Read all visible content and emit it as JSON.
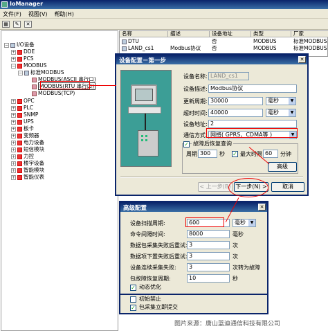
{
  "window": {
    "title": "IoManager"
  },
  "menubar": [
    "文件(F)",
    "视图(V)",
    "帮助(H)"
  ],
  "tree": {
    "root": "I/O设备",
    "items": [
      "DDE",
      "PCS",
      "MODBUS",
      "标准MODBUS",
      "MODBUS(ASCII 串行口)",
      "MODBUS(RTU 串行口)",
      "MODBUS(TCP)",
      "OPC",
      "PLC",
      "SNMP",
      "UPS",
      "板卡",
      "变频器",
      "电力设备",
      "短信模块",
      "力控",
      "楼宇设备",
      "智能模块",
      "智能仪表"
    ]
  },
  "device_list": {
    "columns": [
      "名称",
      "描述",
      "设备地址",
      "类型",
      "厂家"
    ],
    "rows": [
      [
        "DTU",
        "",
        "否",
        "MODBUS",
        "标准MODBUS"
      ],
      [
        "LAND_cs1",
        "Modbus协议",
        "否",
        "MODBUS",
        "标准MODBUS"
      ]
    ]
  },
  "dialog1": {
    "title": "设备配置－第一步",
    "fields": {
      "name_label": "设备名称:",
      "name_value": "LAND_cs1",
      "desc_label": "设备描述:",
      "desc_value": "Modbus协议",
      "update_label": "更新周期:",
      "update_value": "30000",
      "update_unit": "毫秒",
      "timeout_label": "超时时间:",
      "timeout_value": "40000",
      "timeout_unit": "毫秒",
      "addr_label": "设备地址:",
      "addr_value": "2",
      "comm_label": "通信方式:",
      "comm_value": "网络( GPRS、CDMA等 )"
    },
    "recovery": {
      "title": "故障后恢复查询",
      "period_label": "周期:",
      "period_value": "300",
      "period_unit": "秒",
      "max_label": "最大时限",
      "max_value": "60",
      "max_unit": "分钟",
      "max_checked": "✓"
    },
    "advanced_button": "高级",
    "prev_button": "< 上一步(B)",
    "next_button": "下一步(N) >",
    "cancel_button": "取消"
  },
  "dialog2": {
    "title": "高级配置",
    "rows": [
      {
        "label": "设备扫描周期:",
        "value": "600",
        "unit": "毫秒"
      },
      {
        "label": "命令间隔时间:",
        "value": "8000",
        "unit": "毫秒"
      },
      {
        "label": "数据包采集失败后重试:",
        "value": "3",
        "unit": "次"
      },
      {
        "label": "数据项下置失败后重试:",
        "value": "3",
        "unit": "次"
      },
      {
        "label": "设备连续采集失败:",
        "value": "3",
        "unit": "次转为故障"
      },
      {
        "label": "包故障恢复周期:",
        "value": "10",
        "unit": "秒"
      }
    ],
    "checks": [
      {
        "label": "动态优化",
        "checked": "✓"
      },
      {
        "label": "初始禁止",
        "checked": ""
      },
      {
        "label": "包采集立即提交",
        "checked": "✓"
      }
    ]
  },
  "watermark": "图片来源：唐山蓝迪通信科技有限公司",
  "colors": {
    "title_bar": "#0a246a",
    "dialog_bg": "#ece9d8",
    "selection": "#316ac5",
    "annotation": "#ee0000"
  }
}
